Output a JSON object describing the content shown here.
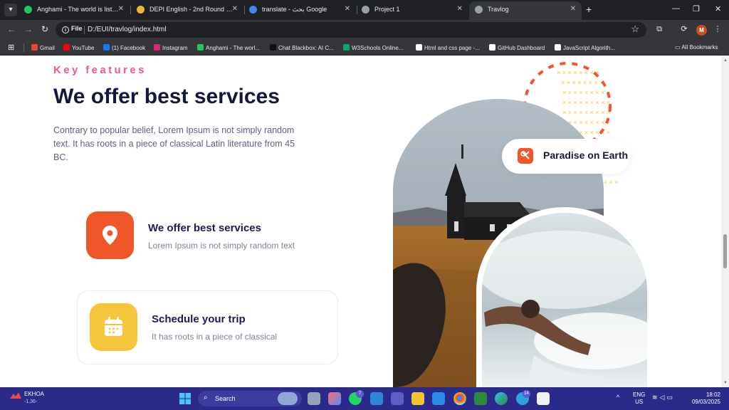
{
  "tabs": [
    {
      "label": "Anghami - The world is listening",
      "color": "#22c55e"
    },
    {
      "label": "DEPI English - 2nd Round - Go",
      "color": "#f2b632"
    },
    {
      "label": "translate - بحث Google",
      "color": "#4285f4"
    },
    {
      "label": "Project 1",
      "color": "#9aa0a6"
    },
    {
      "label": "Travlog",
      "color": "#9aa0a6"
    }
  ],
  "toolbar": {
    "file_chip": "File",
    "url": "D:/EUI/travlog/index.html",
    "profile_initial": "M"
  },
  "bookmarks": [
    {
      "label": "Gmail",
      "color": "#ea4335"
    },
    {
      "label": "YouTube",
      "color": "#ff0000"
    },
    {
      "label": "(1) Facebook",
      "color": "#1877f2"
    },
    {
      "label": "Instagram",
      "color": "#d62976"
    },
    {
      "label": "Anghami - The worl...",
      "color": "#22c55e"
    },
    {
      "label": "Chat Blackbox: AI C...",
      "color": "#111111"
    },
    {
      "label": "W3Schools Online...",
      "color": "#04aa6d"
    },
    {
      "label": "Html and css page -...",
      "color": "#ffffff"
    },
    {
      "label": "GitHub Dashboard",
      "color": "#ffffff"
    },
    {
      "label": "JavaScript Algorith...",
      "color": "#ffffff"
    }
  ],
  "bookmarks_all": "All Bookmarks",
  "page": {
    "kicker": "Key features",
    "heading": "We offer best services",
    "description": "Contrary to popular belief, Lorem Ipsum is not simply random text. It has roots in a piece of classical Latin literature from 45 BC.",
    "features": [
      {
        "title": "We offer best services",
        "subtitle": "Lorem Ipsum is not simply random text",
        "icon": "location-pin-icon",
        "color": "#f1562a"
      },
      {
        "title": "Schedule your trip",
        "subtitle": "It has roots in a piece of classical",
        "icon": "calendar-icon",
        "color": "#f7c53c"
      }
    ],
    "badge_text": "Paradise on Earth",
    "colors": {
      "kicker": "#ee5a8a",
      "heading": "#14183e",
      "accent_orange": "#f1562a",
      "accent_yellow": "#f7c53c"
    }
  },
  "taskbar": {
    "weather_title": "EKHOA",
    "weather_sub": "-1,36-",
    "search_label": "Search",
    "whatsapp_badge": "7",
    "telegram_badge": "14",
    "lang_top": "ENG",
    "lang_bottom": "US",
    "time": "18:02",
    "date": "09/03/2025"
  }
}
